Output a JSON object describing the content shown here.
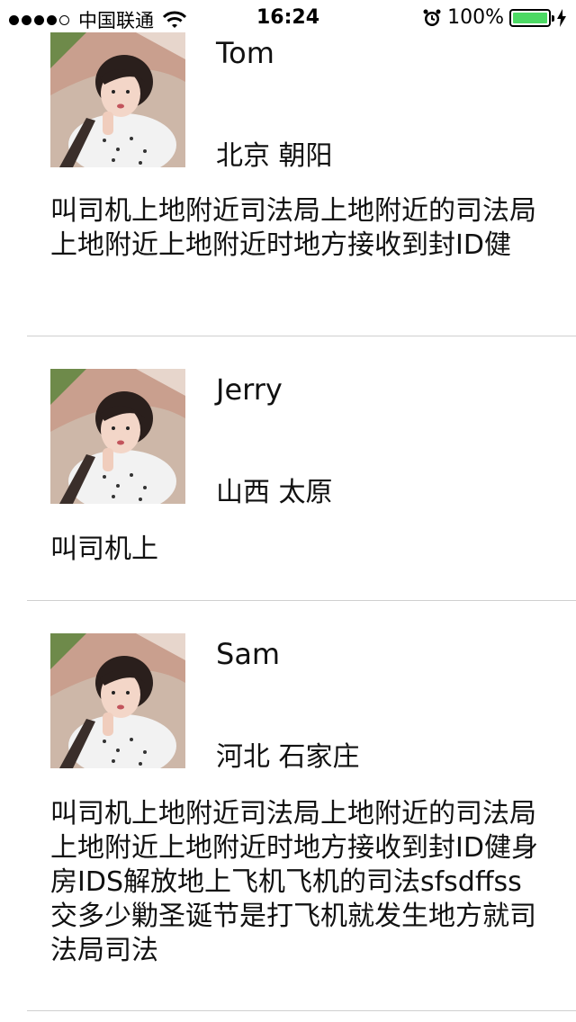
{
  "status_bar": {
    "carrier": "中国联通",
    "time": "16:24",
    "battery": "100%",
    "signal_bars": 4,
    "signal_total": 5,
    "battery_level": 1.0,
    "battery_color": "#4cd964"
  },
  "posts": [
    {
      "name": "Tom",
      "location": "北京 朝阳",
      "content": "叫司机上地附近司法局上地附近的司法局上地附近上地附近时地方接收到封ID健"
    },
    {
      "name": "Jerry",
      "location": "山西 太原",
      "content": "叫司机上"
    },
    {
      "name": "Sam",
      "location": "河北 石家庄",
      "content": "叫司机上地附近司法局上地附近的司法局上地附近上地附近时地方接收到封ID健身房IDS解放地上飞机飞机的司法sfsdffss交多少勦圣诞节是打飞机就发生地方就司法局司法"
    }
  ]
}
